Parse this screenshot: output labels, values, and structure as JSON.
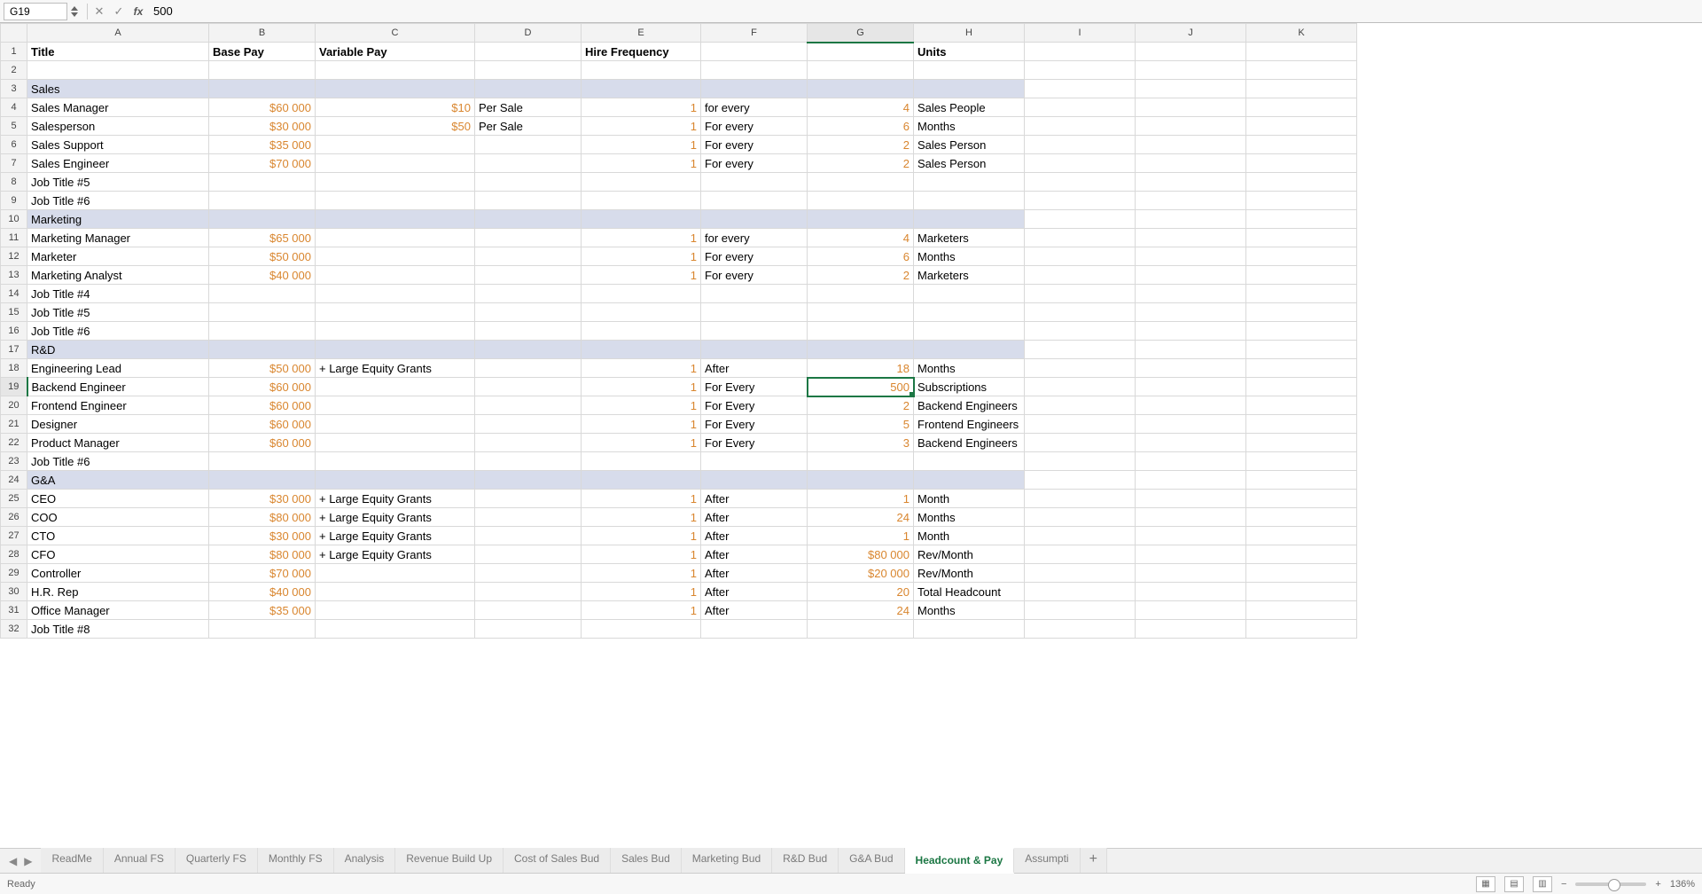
{
  "nameBox": "G19",
  "formula": "500",
  "selected": {
    "row": 19,
    "col": "G"
  },
  "columns": [
    "A",
    "B",
    "C",
    "D",
    "E",
    "F",
    "G",
    "H",
    "I",
    "J",
    "K"
  ],
  "headerRow": {
    "A": "Title",
    "B": "Base Pay",
    "C": "Variable Pay",
    "D": "",
    "E": "Hire Frequency",
    "F": "",
    "G": "",
    "H": "Units",
    "I": "",
    "J": "",
    "K": ""
  },
  "rows": [
    {
      "n": 1,
      "type": "header"
    },
    {
      "n": 2,
      "type": "blank"
    },
    {
      "n": 3,
      "type": "section",
      "A": "Sales"
    },
    {
      "n": 4,
      "A": "Sales Manager",
      "B": "$60 000",
      "C": "$10",
      "D": "Per Sale",
      "E": "1",
      "F": "for every",
      "G": "4",
      "H": "Sales People"
    },
    {
      "n": 5,
      "A": "Salesperson",
      "B": "$30 000",
      "C": "$50",
      "D": "Per Sale",
      "E": "1",
      "F": "For every",
      "G": "6",
      "H": "Months"
    },
    {
      "n": 6,
      "A": "Sales Support",
      "B": "$35 000",
      "E": "1",
      "F": "For every",
      "G": "2",
      "H": "Sales Person"
    },
    {
      "n": 7,
      "A": "Sales Engineer",
      "B": "$70 000",
      "E": "1",
      "F": "For every",
      "G": "2",
      "H": "Sales Person"
    },
    {
      "n": 8,
      "A": "Job Title #5"
    },
    {
      "n": 9,
      "A": "Job Title #6"
    },
    {
      "n": 10,
      "type": "section",
      "A": "Marketing"
    },
    {
      "n": 11,
      "A": "Marketing Manager",
      "B": "$65 000",
      "E": "1",
      "F": "for every",
      "G": "4",
      "H": "Marketers"
    },
    {
      "n": 12,
      "A": "Marketer",
      "B": "$50 000",
      "E": "1",
      "F": "For every",
      "G": "6",
      "H": "Months"
    },
    {
      "n": 13,
      "A": "Marketing Analyst",
      "B": "$40 000",
      "E": "1",
      "F": "For every",
      "G": "2",
      "H": "Marketers"
    },
    {
      "n": 14,
      "A": "Job Title #4"
    },
    {
      "n": 15,
      "A": "Job Title #5"
    },
    {
      "n": 16,
      "A": "Job Title #6"
    },
    {
      "n": 17,
      "type": "section",
      "A": "R&D"
    },
    {
      "n": 18,
      "A": "Engineering Lead",
      "B": "$50 000",
      "C": "+ Large Equity Grants",
      "Cstyle": "text",
      "E": "1",
      "F": "After",
      "G": "18",
      "H": "Months"
    },
    {
      "n": 19,
      "A": "Backend Engineer",
      "B": "$60 000",
      "E": "1",
      "F": "For Every",
      "G": "500",
      "H": "Subscriptions",
      "Gsel": true
    },
    {
      "n": 20,
      "A": "Frontend Engineer",
      "B": "$60 000",
      "E": "1",
      "F": "For Every",
      "G": "2",
      "H": "Backend Engineers"
    },
    {
      "n": 21,
      "A": "Designer",
      "B": "$60 000",
      "E": "1",
      "F": "For Every",
      "G": "5",
      "H": "Frontend Engineers"
    },
    {
      "n": 22,
      "A": "Product Manager",
      "B": "$60 000",
      "E": "1",
      "F": "For Every",
      "G": "3",
      "H": "Backend Engineers"
    },
    {
      "n": 23,
      "A": "Job Title #6"
    },
    {
      "n": 24,
      "type": "section",
      "A": "G&A"
    },
    {
      "n": 25,
      "A": "CEO",
      "B": "$30 000",
      "C": "+ Large Equity Grants",
      "Cstyle": "text",
      "E": "1",
      "F": "After",
      "G": "1",
      "H": "Month"
    },
    {
      "n": 26,
      "A": "COO",
      "B": "$80 000",
      "C": "+ Large Equity Grants",
      "Cstyle": "text",
      "E": "1",
      "F": "After",
      "G": "24",
      "H": "Months"
    },
    {
      "n": 27,
      "A": "CTO",
      "B": "$30 000",
      "C": "+ Large Equity Grants",
      "Cstyle": "text",
      "E": "1",
      "F": "After",
      "G": "1",
      "H": "Month"
    },
    {
      "n": 28,
      "A": "CFO",
      "B": "$80 000",
      "C": "+ Large Equity Grants",
      "Cstyle": "text",
      "E": "1",
      "F": "After",
      "G": "$80 000",
      "H": "Rev/Month"
    },
    {
      "n": 29,
      "A": "Controller",
      "B": "$70 000",
      "E": "1",
      "F": "After",
      "G": "$20 000",
      "H": "Rev/Month"
    },
    {
      "n": 30,
      "A": "H.R. Rep",
      "B": "$40 000",
      "E": "1",
      "F": "After",
      "G": "20",
      "H": "Total Headcount"
    },
    {
      "n": 31,
      "A": "Office Manager",
      "B": "$35 000",
      "E": "1",
      "F": "After",
      "G": "24",
      "H": "Months"
    },
    {
      "n": 32,
      "A": "Job Title #8"
    }
  ],
  "tabs": [
    "ReadMe",
    "Annual FS",
    "Quarterly FS",
    "Monthly FS",
    "Analysis",
    "Revenue Build Up",
    "Cost of Sales Bud",
    "Sales Bud",
    "Marketing Bud",
    "R&D Bud",
    "G&A Bud",
    "Headcount & Pay",
    "Assumpti"
  ],
  "activeTab": "Headcount & Pay",
  "status": "Ready",
  "zoom": "136%"
}
